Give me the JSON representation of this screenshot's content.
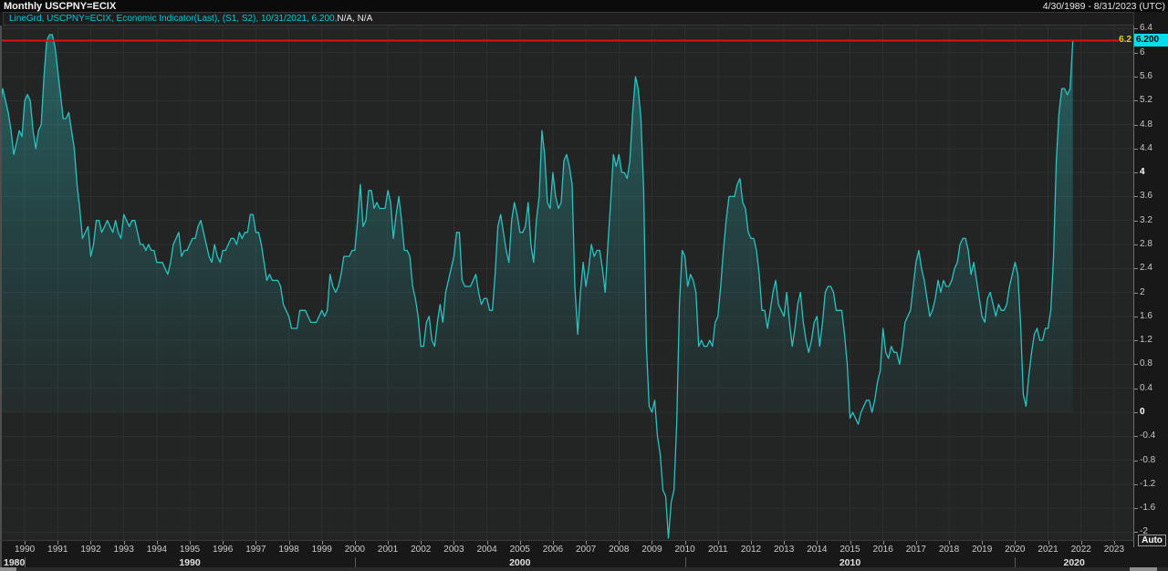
{
  "window": {
    "title": "Monthly USCPNY=ECIX",
    "date_range": "4/30/1989 - 8/31/2023 (UTC)"
  },
  "legend": {
    "primary": "LineGrd, USCPNY=ECIX, Economic Indicator(Last), (S1, S2), 10/31/2021, 6.200,",
    "secondary": " N/A, N/A"
  },
  "price_marker": {
    "red_line_label": "6.2",
    "last_price_badge": "6.200"
  },
  "auto_button_label": "Auto",
  "colors": {
    "line": "#2cc2c2",
    "fill_top": "rgba(44,194,194,0.40)",
    "fill_mid": "rgba(44,180,180,0.20)",
    "fill_bottom": "rgba(44,160,160,0.06)",
    "red_line": "#e01010",
    "yellow_label": "#e3cf2a",
    "badge_bg": "#00dff0",
    "badge_text": "#000000",
    "legend_cyan": "#00c8dc",
    "axis_text": "#c8c8c8",
    "axis_text_bold": "#ffffff",
    "grid": "#2d2e2e",
    "plot_bg": "#232424"
  },
  "chart_data": {
    "type": "line",
    "title": "Monthly USCPNY=ECIX",
    "series_name": "USCPNY=ECIX, Economic Indicator(Last)",
    "frequency": "monthly",
    "x_start": "1989-04",
    "x_end_axis": "2023-08",
    "x_end_data": "2021-10",
    "ylim": [
      -2.0,
      6.4
    ],
    "y_tick_step": 0.4,
    "bold_y_ticks": [
      4,
      0
    ],
    "red_line_value": 6.2,
    "last_value": 6.2,
    "last_date": "10/31/2021",
    "grid": true,
    "x_year_labels": [
      1990,
      1991,
      1992,
      1993,
      1994,
      1995,
      1996,
      1997,
      1998,
      1999,
      2000,
      2001,
      2002,
      2003,
      2004,
      2005,
      2006,
      2007,
      2008,
      2009,
      2010,
      2011,
      2012,
      2013,
      2014,
      2015,
      2016,
      2017,
      2018,
      2019,
      2020,
      2021,
      2022,
      2023
    ],
    "decade_labels": [
      "1980",
      "1990",
      "2000",
      "2010",
      "2020"
    ],
    "values": [
      5.1,
      5.4,
      5.2,
      5.0,
      4.7,
      4.3,
      4.5,
      4.7,
      4.6,
      5.2,
      5.3,
      5.2,
      4.7,
      4.4,
      4.7,
      4.8,
      5.6,
      6.2,
      6.3,
      6.3,
      6.1,
      5.7,
      5.3,
      4.9,
      4.9,
      5.0,
      4.7,
      4.4,
      3.8,
      3.4,
      2.9,
      3.0,
      3.1,
      2.6,
      2.8,
      3.2,
      3.2,
      3.0,
      3.1,
      3.2,
      3.1,
      3.0,
      3.2,
      3.0,
      2.9,
      3.3,
      3.2,
      3.1,
      3.2,
      3.2,
      3.0,
      2.8,
      2.8,
      2.7,
      2.8,
      2.7,
      2.7,
      2.5,
      2.5,
      2.5,
      2.4,
      2.3,
      2.5,
      2.8,
      2.9,
      3.0,
      2.6,
      2.7,
      2.7,
      2.8,
      2.9,
      2.9,
      3.1,
      3.2,
      3.0,
      2.8,
      2.6,
      2.5,
      2.8,
      2.6,
      2.5,
      2.7,
      2.7,
      2.8,
      2.9,
      2.9,
      2.8,
      3.0,
      2.9,
      3.0,
      3.0,
      3.3,
      3.3,
      3.0,
      3.0,
      2.8,
      2.5,
      2.2,
      2.3,
      2.2,
      2.2,
      2.2,
      2.1,
      1.8,
      1.7,
      1.6,
      1.4,
      1.4,
      1.4,
      1.7,
      1.7,
      1.7,
      1.6,
      1.5,
      1.5,
      1.5,
      1.6,
      1.7,
      1.6,
      1.7,
      2.3,
      2.1,
      2.0,
      2.1,
      2.3,
      2.6,
      2.6,
      2.6,
      2.7,
      2.7,
      3.2,
      3.8,
      3.1,
      3.2,
      3.7,
      3.7,
      3.4,
      3.5,
      3.4,
      3.4,
      3.4,
      3.7,
      3.5,
      2.9,
      3.3,
      3.6,
      3.2,
      2.7,
      2.7,
      2.6,
      2.1,
      1.9,
      1.6,
      1.1,
      1.1,
      1.5,
      1.6,
      1.2,
      1.1,
      1.5,
      1.8,
      1.5,
      2.0,
      2.2,
      2.4,
      2.6,
      3.0,
      3.0,
      2.2,
      2.1,
      2.1,
      2.1,
      2.2,
      2.3,
      2.0,
      1.8,
      1.9,
      1.9,
      1.7,
      1.7,
      2.3,
      3.1,
      3.3,
      3.0,
      2.7,
      2.5,
      3.2,
      3.5,
      3.3,
      3.0,
      3.0,
      3.1,
      3.5,
      2.8,
      2.5,
      3.2,
      3.6,
      4.7,
      4.3,
      3.5,
      3.4,
      4.0,
      3.6,
      3.4,
      3.5,
      4.2,
      4.3,
      4.1,
      3.8,
      2.1,
      1.3,
      2.0,
      2.5,
      2.1,
      2.4,
      2.8,
      2.6,
      2.7,
      2.7,
      2.4,
      2.0,
      2.8,
      3.5,
      4.3,
      4.1,
      4.3,
      4.0,
      4.0,
      3.9,
      4.2,
      5.0,
      5.6,
      5.4,
      4.9,
      3.7,
      1.1,
      0.1,
      0.0,
      0.2,
      -0.4,
      -0.7,
      -1.3,
      -1.4,
      -2.1,
      -1.5,
      -1.3,
      -0.2,
      1.8,
      2.7,
      2.6,
      2.1,
      2.3,
      2.2,
      2.0,
      1.1,
      1.2,
      1.1,
      1.1,
      1.2,
      1.1,
      1.5,
      1.6,
      2.1,
      2.7,
      3.2,
      3.6,
      3.6,
      3.6,
      3.8,
      3.9,
      3.5,
      3.4,
      3.0,
      2.9,
      2.9,
      2.7,
      2.3,
      1.7,
      1.7,
      1.4,
      1.7,
      2.0,
      2.2,
      1.8,
      1.7,
      1.6,
      2.0,
      1.5,
      1.1,
      1.4,
      1.8,
      2.0,
      1.5,
      1.2,
      1.0,
      1.2,
      1.5,
      1.6,
      1.1,
      1.5,
      2.0,
      2.1,
      2.1,
      2.0,
      1.7,
      1.7,
      1.7,
      1.3,
      0.8,
      -0.1,
      0.0,
      -0.1,
      -0.2,
      0.0,
      0.1,
      0.2,
      0.2,
      0.0,
      0.2,
      0.5,
      0.7,
      1.4,
      1.0,
      0.9,
      1.1,
      1.0,
      1.0,
      0.8,
      1.1,
      1.5,
      1.6,
      1.7,
      2.1,
      2.5,
      2.7,
      2.4,
      2.2,
      1.9,
      1.6,
      1.7,
      1.9,
      2.2,
      2.0,
      2.2,
      2.1,
      2.1,
      2.2,
      2.4,
      2.5,
      2.8,
      2.9,
      2.9,
      2.7,
      2.3,
      2.5,
      2.2,
      1.9,
      1.6,
      1.5,
      1.9,
      2.0,
      1.8,
      1.6,
      1.8,
      1.7,
      1.7,
      1.8,
      2.1,
      2.3,
      2.5,
      2.3,
      1.5,
      0.3,
      0.1,
      0.6,
      1.0,
      1.3,
      1.4,
      1.2,
      1.2,
      1.4,
      1.4,
      1.7,
      2.6,
      4.2,
      5.0,
      5.4,
      5.4,
      5.3,
      5.4,
      6.2
    ]
  }
}
